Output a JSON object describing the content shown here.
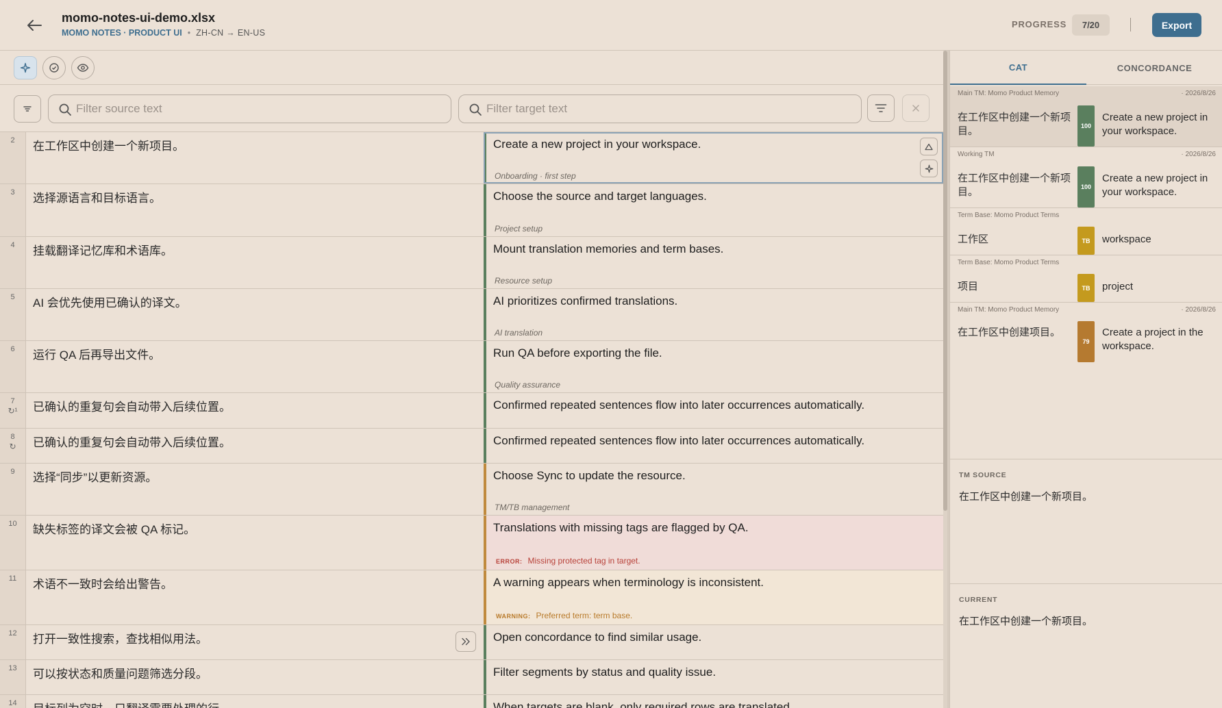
{
  "header": {
    "file_name": "momo-notes-ui-demo.xlsx",
    "project": "MOMO NOTES · PRODUCT UI",
    "separator": "•",
    "lang_pair": "ZH-CN → EN-US",
    "progress_label": "PROGRESS",
    "progress_value": "7/20",
    "export_label": "Export"
  },
  "filters": {
    "source_placeholder": "Filter source text",
    "target_placeholder": "Filter target text"
  },
  "segments": [
    {
      "num": "2",
      "source": "在工作区中创建一个新项目。",
      "target": "Create a new project in your workspace.",
      "note": "Onboarding · first step"
    },
    {
      "num": "3",
      "source": "选择源语言和目标语言。",
      "target": "Choose the source and target languages.",
      "note": "Project setup"
    },
    {
      "num": "4",
      "source": "挂载翻译记忆库和术语库。",
      "target": "Mount translation memories and term bases.",
      "note": "Resource setup"
    },
    {
      "num": "5",
      "source": "AI 会优先使用已确认的译文。",
      "target": "AI prioritizes confirmed translations.",
      "note": "AI translation"
    },
    {
      "num": "6",
      "source": "运行 QA 后再导出文件。",
      "target": "Run QA before exporting the file.",
      "note": "Quality assurance"
    },
    {
      "num": "7",
      "rep": "↻¹",
      "source": "已确认的重复句会自动带入后续位置。",
      "target": "Confirmed repeated sentences flow into later occurrences automatically."
    },
    {
      "num": "8",
      "rep": "↻",
      "source": "已确认的重复句会自动带入后续位置。",
      "target": "Confirmed repeated sentences flow into later occurrences automatically."
    },
    {
      "num": "9",
      "source": "选择“同步”以更新资源。",
      "target": "Choose Sync to update the resource.",
      "note": "TM/TB management"
    },
    {
      "num": "10",
      "source": "缺失标签的译文会被 QA 标记。",
      "target": "Translations with missing tags are flagged by QA.",
      "issue_label": "ERROR:",
      "issue_text": "Missing protected tag in target."
    },
    {
      "num": "11",
      "source": "术语不一致时会给出警告。",
      "target": "A warning appears when terminology is inconsistent.",
      "issue_label": "WARNING:",
      "issue_text": "Preferred term: term base."
    },
    {
      "num": "12",
      "source": "打开一致性搜索，查找相似用法。",
      "target": "Open concordance to find similar usage."
    },
    {
      "num": "13",
      "source": "可以按状态和质量问题筛选分段。",
      "target": "Filter segments by status and quality issue."
    },
    {
      "num": "14",
      "source": "目标列为空时，只翻译需要处理的行。",
      "target": "When targets are blank, only required rows are translated."
    }
  ],
  "panel": {
    "tabs": [
      "CAT",
      "CONCORDANCE"
    ],
    "matches": [
      {
        "origin": "Main TM: Momo Product Memory",
        "date": "· 2026/8/26",
        "source": "在工作区中创建一个新项目。",
        "score": "100",
        "target": "Create a new project in your workspace.",
        "color": "#5a7f5e"
      },
      {
        "origin": "Working TM",
        "date": "· 2026/8/26",
        "source": "在工作区中创建一个新项目。",
        "score": "100",
        "target": "Create a new project in your workspace.",
        "color": "#5a7f5e"
      },
      {
        "origin": "Term Base: Momo Product Terms",
        "date": "",
        "source": "工作区",
        "score": "TB",
        "target": "workspace",
        "color": "#c49a1e"
      },
      {
        "origin": "Term Base: Momo Product Terms",
        "date": "",
        "source": "项目",
        "score": "TB",
        "target": "project",
        "color": "#c49a1e"
      },
      {
        "origin": "Main TM: Momo Product Memory",
        "date": "· 2026/8/26",
        "source": "在工作区中创建项目。",
        "score": "79",
        "target": "Create a project in the workspace.",
        "color": "#b57a30"
      }
    ],
    "tm_source_label": "TM SOURCE",
    "tm_source_text": "在工作区中创建一个新项目。",
    "current_label": "CURRENT",
    "current_text": "在工作区中创建一个新项目。"
  }
}
